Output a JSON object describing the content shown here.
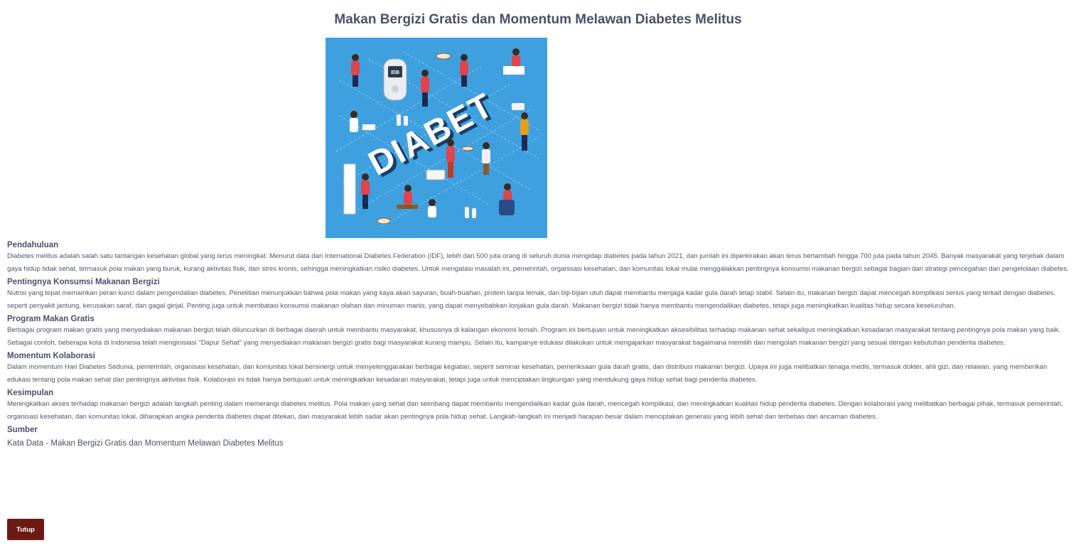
{
  "page": {
    "title": "Makan Bergizi Gratis dan Momentum Melawan Diabetes Melitus"
  },
  "hero_image": {
    "word": "DIABET",
    "device_label": "IDB",
    "background_color": "#3fa0e0"
  },
  "sections": [
    {
      "heading": "Pendahuluan",
      "text": "Diabetes melitus adalah salah satu tantangan kesehatan global yang terus meningkat. Menurut data dari International Diabetes Federation (IDF), lebih dari 500 juta orang di seluruh dunia mengidap diabetes pada tahun 2021, dan jumlah ini diperkirakan akan terus bertambah hingga 700 juta pada tahun 2045. Banyak masyarakat yang terjebak dalam gaya hidup tidak sehat, termasuk pola makan yang buruk, kurang aktivitas fisik, dan stres kronis, sehingga meningkatkan risiko diabetes. Untuk mengatasi masalah ini, pemerintah, organisasi kesehatan, dan komunitas lokal mulai menggalakkan pentingnya konsumsi makanan bergizi sebagai bagian dari strategi pencegahan dan pengelolaan diabetes."
    },
    {
      "heading": "Pentingnya Konsumsi Makanan Bergizi",
      "text": "Nutrisi yang tepat memainkan peran kunci dalam pengendalian diabetes. Penelitian menunjukkan bahwa pola makan yang kaya akan sayuran, buah-buahan, protein tanpa lemak, dan biji-bijian utuh dapat membantu menjaga kadar gula darah tetap stabil. Selain itu, makanan bergizi dapat mencegah komplikasi serius yang terkait dengan diabetes, seperti penyakit jantung, kerusakan saraf, dan gagal ginjal. Penting juga untuk membatasi konsumsi makanan olahan dan minuman manis, yang dapat menyebabkan lonjakan gula darah. Makanan bergizi tidak hanya membantu mengendalikan diabetes, tetapi juga meningkatkan kualitas hidup secara keseluruhan."
    },
    {
      "heading": "Program Makan Gratis",
      "text": "Berbagai program makan gratis yang menyediakan makanan bergizi telah diluncurkan di berbagai daerah untuk membantu masyarakat, khususnya di kalangan ekonomi lemah. Program ini bertujuan untuk meningkatkan aksesibilitas terhadap makanan sehat sekaligus meningkatkan kesadaran masyarakat tentang pentingnya pola makan yang baik. Sebagai contoh, beberapa kota di Indonesia telah menginisiasi \"Dapur Sehat\" yang menyediakan makanan bergizi gratis bagi masyarakat kurang mampu. Selain itu, kampanye edukasi dilakukan untuk mengajarkan masyarakat bagaimana memilih dan mengolah makanan bergizi yang sesuai dengan kebutuhan penderita diabetes."
    },
    {
      "heading": "Momentum Kolaborasi",
      "text": "Dalam momentum Hari Diabetes Sedunia, pemerintah, organisasi kesehatan, dan komunitas lokal bersinergi untuk menyelenggarakan berbagai kegiatan, seperti seminar kesehatan, pemeriksaan gula darah gratis, dan distribusi makanan bergizi. Upaya ini juga melibatkan tenaga medis, termasuk dokter, ahli gizi, dan relawan, yang memberikan edukasi tentang pola makan sehat dan pentingnya aktivitas fisik. Kolaborasi ini tidak hanya bertujuan untuk meningkatkan kesadaran masyarakat, tetapi juga untuk menciptakan lingkungan yang mendukung gaya hidup sehat bagi penderita diabetes."
    },
    {
      "heading": "Kesimpulan",
      "text": "Meningkatkan akses terhadap makanan bergizi adalah langkah penting dalam memerangi diabetes melitus. Pola makan yang sehat dan seimbang dapat membantu mengendalikan kadar gula darah, mencegah komplikasi, dan meningkatkan kualitas hidup penderita diabetes. Dengan kolaborasi yang melibatkan berbagai pihak, termasuk pemerintah, organisasi kesehatan, dan komunitas lokal, diharapkan angka penderita diabetes dapat ditekan, dan masyarakat lebih sadar akan pentingnya pola hidup sehat. Langkah-langkah ini menjadi harapan besar dalam menciptakan generasi yang lebih sehat dan terbebas dari ancaman diabetes."
    }
  ],
  "source": {
    "heading": "Sumber",
    "text": "Kata Data - Makan Bergizi Gratis dan Momentum Melawan Diabetes Melitus"
  },
  "close_button": {
    "label": "Tutup",
    "color": "#6b1a14"
  }
}
